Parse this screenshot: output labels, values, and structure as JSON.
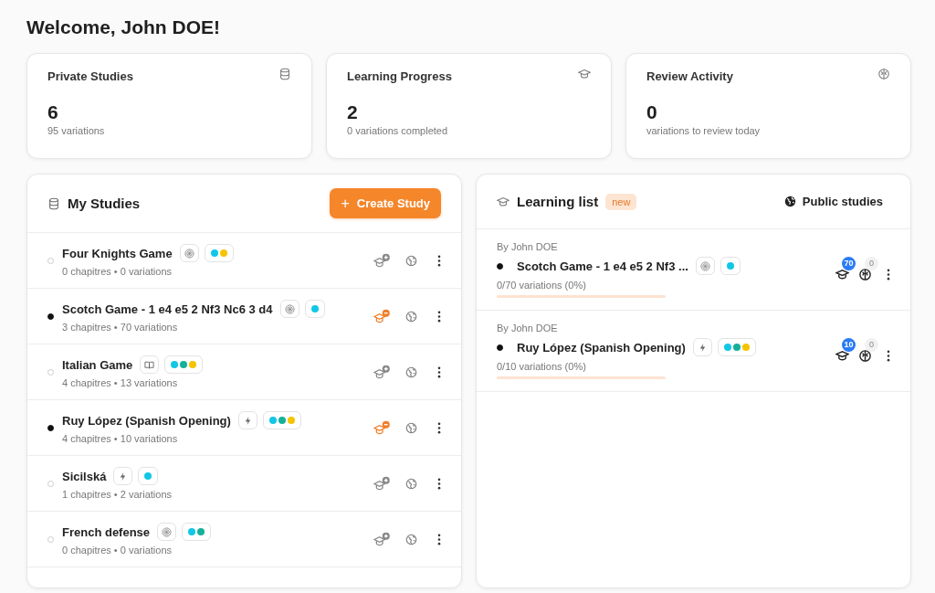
{
  "heading": "Welcome, John DOE!",
  "stats": [
    {
      "title": "Private Studies",
      "kind": "database",
      "value": "6",
      "caption": "95 variations"
    },
    {
      "title": "Learning Progress",
      "kind": "cap",
      "value": "2",
      "caption": "0 variations completed"
    },
    {
      "title": "Review Activity",
      "kind": "brain",
      "value": "0",
      "caption": "variations to review today"
    }
  ],
  "studies": {
    "title": "My Studies",
    "create_button": "Create Study",
    "create_icon": "+",
    "items": [
      {
        "name": "Four Knights Game",
        "meta": "0 chapitres • 0 variations",
        "in_learning": false,
        "kind": "target",
        "tags": [
          {
            "color": "#12c7e6"
          },
          {
            "color": "#f5c400"
          }
        ]
      },
      {
        "name": "Scotch Game - 1 e4 e5 2 Nf3 Nc6 3 d4",
        "meta": "3 chapitres • 70 variations",
        "in_learning": true,
        "kind": "target",
        "tags": [
          {
            "color": "#12c7e6"
          }
        ]
      },
      {
        "name": "Italian Game",
        "meta": "4 chapitres • 13 variations",
        "in_learning": false,
        "kind": "book",
        "tags": [
          {
            "color": "#12c7e6"
          },
          {
            "color": "#14b09a"
          },
          {
            "color": "#f5c400"
          }
        ]
      },
      {
        "name": "Ruy López (Spanish Opening)",
        "meta": "4 chapitres • 10 variations",
        "in_learning": true,
        "kind": "bolt",
        "tags": [
          {
            "color": "#12c7e6"
          },
          {
            "color": "#14b09a"
          },
          {
            "color": "#f5c400"
          }
        ]
      },
      {
        "name": "Sicilská",
        "meta": "1 chapitres • 2 variations",
        "in_learning": false,
        "kind": "bolt",
        "tags": [
          {
            "color": "#12c7e6"
          }
        ]
      },
      {
        "name": "French defense",
        "meta": "0 chapitres • 0 variations",
        "in_learning": false,
        "kind": "target",
        "tags": [
          {
            "color": "#12c7e6"
          },
          {
            "color": "#14b09a"
          }
        ]
      }
    ]
  },
  "learning": {
    "title": "Learning list",
    "badge": "new",
    "public_link": "Public studies",
    "items": [
      {
        "author": "By John DOE",
        "name": "Scotch Game - 1 e4 e5 2 Nf3 ...",
        "kind": "target",
        "tags": [
          {
            "color": "#12c7e6"
          }
        ],
        "progress": "0/70 variations (0%)",
        "level": 0,
        "learn_count": "70",
        "review_count": "0"
      },
      {
        "author": "By John DOE",
        "name": "Ruy López (Spanish Opening)",
        "kind": "bolt",
        "tags": [
          {
            "color": "#12c7e6"
          },
          {
            "color": "#14b09a"
          },
          {
            "color": "#f5c400"
          }
        ],
        "progress": "0/10 variations (0%)",
        "level": 0,
        "learn_count": "10",
        "review_count": "0"
      }
    ]
  }
}
